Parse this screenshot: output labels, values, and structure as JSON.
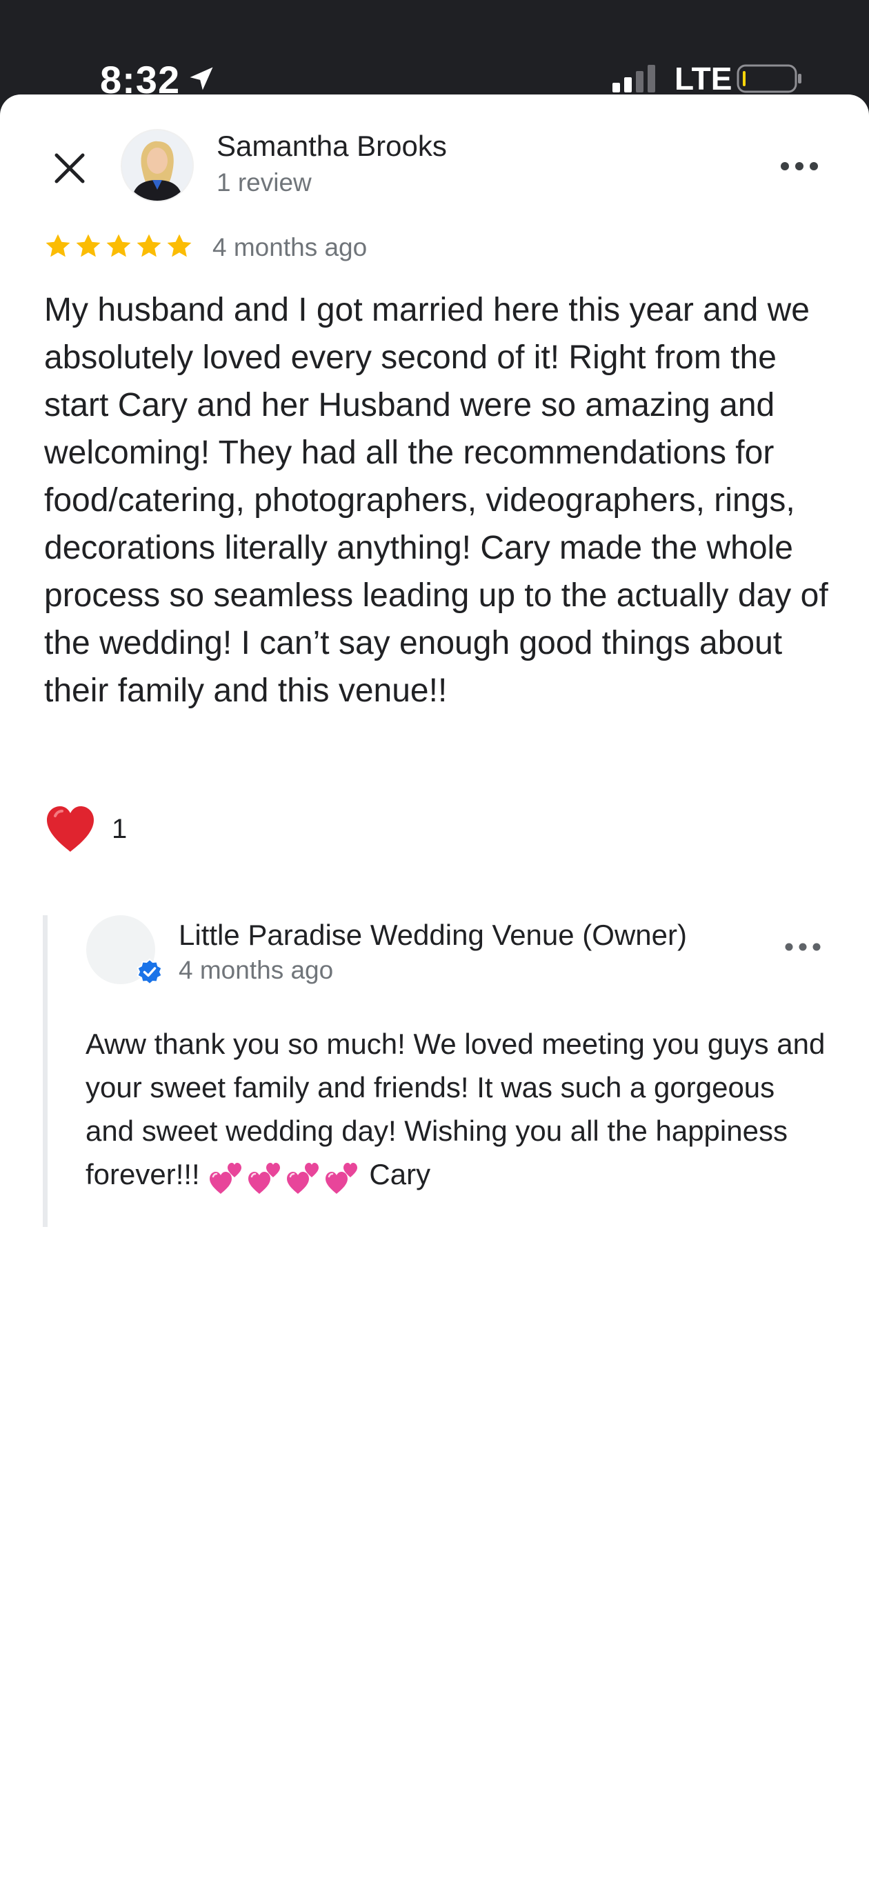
{
  "status_bar": {
    "time": "8:32",
    "network": "LTE"
  },
  "review": {
    "reviewer_name": "Samantha Brooks",
    "review_count": "1 review",
    "rating": 5,
    "date": "4 months ago",
    "text": "My husband and I got married here this year and we absolutely loved every second of it! Right from the start Cary and her Husband were so amazing and welcoming! They had all the recommendations for food/catering, photographers, videographers, rings, decorations literally anything! Cary made the whole process so seamless leading up to the actually day of the wedding! I can’t say enough good things about their family and this venue!!",
    "like_count": "1"
  },
  "owner_reply": {
    "name": "Little Paradise Wedding Venue (Owner)",
    "date": "4 months ago",
    "text": "Aww thank you so much! We loved meeting you guys and your sweet family and friends! It was such a gorgeous and sweet wedding day! Wishing you all the happiness forever!!!",
    "signature": "Cary"
  },
  "icons": {
    "close": "close-icon",
    "more": "more-horizontal-icon",
    "star": "star-icon",
    "like": "heart-icon",
    "verified": "verified-badge-icon",
    "emoji": "two-hearts-icon"
  },
  "colors": {
    "status_bar": "#1f2024",
    "star": "#fbbc04",
    "text": "#202124",
    "secondary_text": "#70757a",
    "verified": "#1a73e8",
    "heart": "#e0242f",
    "emoji_heart": "#e8459a"
  }
}
